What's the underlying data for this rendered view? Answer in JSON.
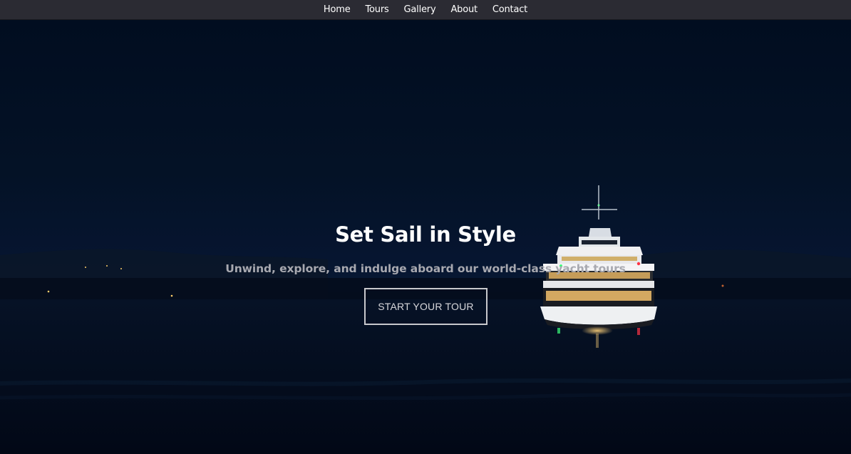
{
  "nav": {
    "items": [
      {
        "label": "Home"
      },
      {
        "label": "Tours"
      },
      {
        "label": "Gallery"
      },
      {
        "label": "About"
      },
      {
        "label": "Contact"
      }
    ]
  },
  "hero": {
    "title": "Set Sail in Style",
    "subtitle": "Unwind, explore, and indulge aboard our world-class yacht tours",
    "cta_label": "START YOUR TOUR",
    "background_image": "yacht-at-night"
  },
  "colors": {
    "navbar_bg": "#2b2b33",
    "hero_bg": "#041226",
    "title": "#ffffff",
    "subtitle": "#a8a9b0",
    "button_border": "#c8c8cc"
  }
}
